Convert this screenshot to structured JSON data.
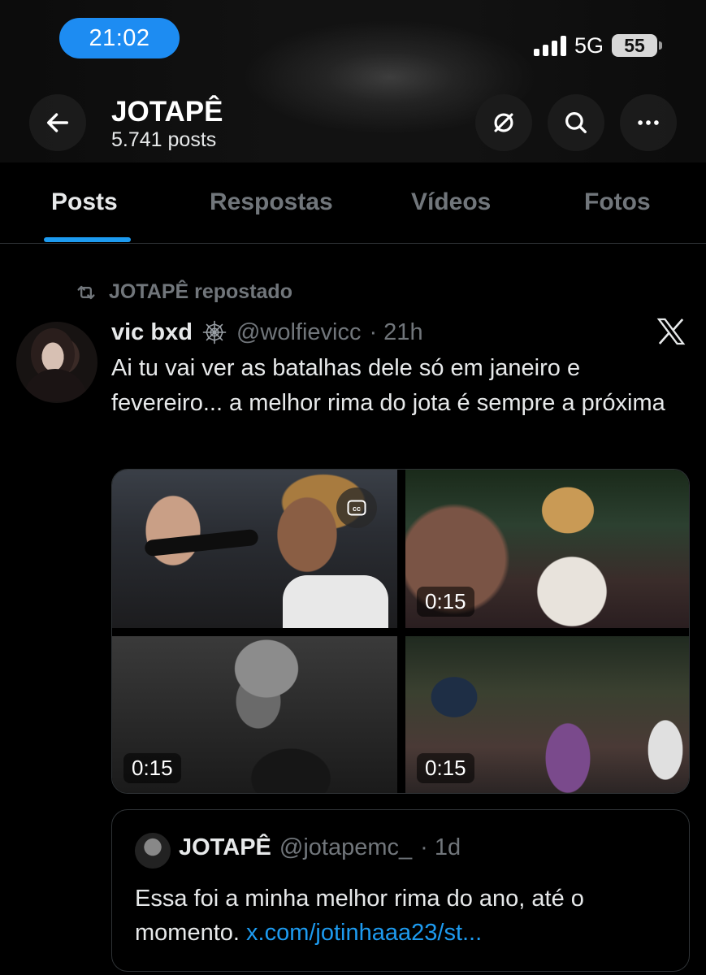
{
  "status_bar": {
    "time": "21:02",
    "network": "5G",
    "battery": "55"
  },
  "profile": {
    "name": "JOTAPÊ",
    "posts_count": "5.741 posts"
  },
  "tabs": [
    {
      "label": "Posts",
      "active": true
    },
    {
      "label": "Respostas",
      "active": false
    },
    {
      "label": "Vídeos",
      "active": false
    },
    {
      "label": "Fotos",
      "active": false
    }
  ],
  "post": {
    "repost_label": "JOTAPÊ repostado",
    "author_name": "vic bxd",
    "author_handle": "@wolfievicc",
    "time": "· 21h",
    "text": "Ai tu vai ver as batalhas dele só em janeiro e fevereiro... a melhor rima do jota é sempre a próxima",
    "media": [
      {
        "duration": "",
        "cc": true
      },
      {
        "duration": "0:15"
      },
      {
        "duration": "0:15"
      },
      {
        "duration": "0:15"
      }
    ]
  },
  "quote": {
    "author_name": "JOTAPÊ",
    "author_handle": "@jotapemc_",
    "time": "· 1d",
    "text": "Essa foi a minha melhor rima do ano, até o momento.",
    "link": "x.com/jotinhaaa23/st..."
  },
  "icons": {
    "back": "arrow-left-icon",
    "unlock": "link-off-icon",
    "search": "search-icon",
    "more": "more-horizontal-icon",
    "repost": "repost-icon",
    "verified_badge": "spiderweb-badge-icon",
    "brand": "x-logo-icon",
    "cc": "closed-captions-icon"
  },
  "colors": {
    "accent": "#1d9bf0",
    "status_time_pill": "#1d8cf2",
    "muted_text": "#71767b",
    "text": "#e7e9ea",
    "background": "#000000"
  }
}
